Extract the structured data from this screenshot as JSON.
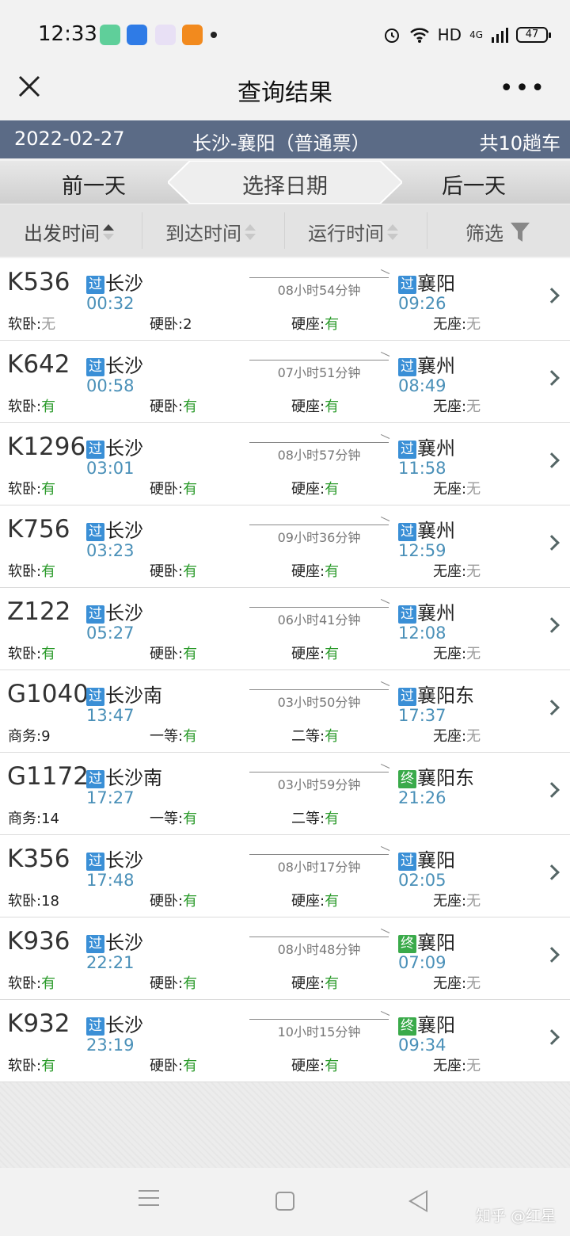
{
  "status_bar": {
    "time": "12:33",
    "network": "HD",
    "signal": "4G",
    "battery": "47"
  },
  "title_bar": {
    "title": "查询结果",
    "more": "•••"
  },
  "route": {
    "date": "2022-02-27",
    "name": "长沙-襄阳（普通票）",
    "count": "共10趟车"
  },
  "day_nav": {
    "prev": "前一天",
    "center": "选择日期",
    "next": "后一天"
  },
  "sort_bar": {
    "depart": "出发时间",
    "arrive": "到达时间",
    "duration": "运行时间",
    "filter": "筛选"
  },
  "colors": {
    "header_bg": "#5b6b86",
    "time_blue": "#4a90b8",
    "available_green": "#2a9a2a",
    "pass_badge": "#3a8fd6",
    "end_badge": "#3aaa4a"
  },
  "trains": [
    {
      "no": "K536",
      "from_badge": "过",
      "from": "长沙",
      "from_time": "00:32",
      "duration": "08小时54分钟",
      "to_badge": "过",
      "to": "襄阳",
      "to_time": "09:26",
      "seats": [
        {
          "label": "软卧:",
          "value": "无"
        },
        {
          "label": "硬卧:",
          "value": "2"
        },
        {
          "label": "硬座:",
          "value": "有"
        },
        {
          "label": "无座:",
          "value": "无"
        }
      ]
    },
    {
      "no": "K642",
      "from_badge": "过",
      "from": "长沙",
      "from_time": "00:58",
      "duration": "07小时51分钟",
      "to_badge": "过",
      "to": "襄州",
      "to_time": "08:49",
      "seats": [
        {
          "label": "软卧:",
          "value": "有"
        },
        {
          "label": "硬卧:",
          "value": "有"
        },
        {
          "label": "硬座:",
          "value": "有"
        },
        {
          "label": "无座:",
          "value": "无"
        }
      ]
    },
    {
      "no": "K1296",
      "from_badge": "过",
      "from": "长沙",
      "from_time": "03:01",
      "duration": "08小时57分钟",
      "to_badge": "过",
      "to": "襄州",
      "to_time": "11:58",
      "seats": [
        {
          "label": "软卧:",
          "value": "有"
        },
        {
          "label": "硬卧:",
          "value": "有"
        },
        {
          "label": "硬座:",
          "value": "有"
        },
        {
          "label": "无座:",
          "value": "无"
        }
      ]
    },
    {
      "no": "K756",
      "from_badge": "过",
      "from": "长沙",
      "from_time": "03:23",
      "duration": "09小时36分钟",
      "to_badge": "过",
      "to": "襄州",
      "to_time": "12:59",
      "seats": [
        {
          "label": "软卧:",
          "value": "有"
        },
        {
          "label": "硬卧:",
          "value": "有"
        },
        {
          "label": "硬座:",
          "value": "有"
        },
        {
          "label": "无座:",
          "value": "无"
        }
      ]
    },
    {
      "no": "Z122",
      "from_badge": "过",
      "from": "长沙",
      "from_time": "05:27",
      "duration": "06小时41分钟",
      "to_badge": "过",
      "to": "襄州",
      "to_time": "12:08",
      "seats": [
        {
          "label": "软卧:",
          "value": "有"
        },
        {
          "label": "硬卧:",
          "value": "有"
        },
        {
          "label": "硬座:",
          "value": "有"
        },
        {
          "label": "无座:",
          "value": "无"
        }
      ]
    },
    {
      "no": "G1040",
      "from_badge": "过",
      "from": "长沙南",
      "from_time": "13:47",
      "duration": "03小时50分钟",
      "to_badge": "过",
      "to": "襄阳东",
      "to_time": "17:37",
      "seats": [
        {
          "label": "商务:",
          "value": "9"
        },
        {
          "label": "一等:",
          "value": "有"
        },
        {
          "label": "二等:",
          "value": "有"
        },
        {
          "label": "无座:",
          "value": "无"
        }
      ]
    },
    {
      "no": "G1172",
      "from_badge": "过",
      "from": "长沙南",
      "from_time": "17:27",
      "duration": "03小时59分钟",
      "to_badge": "终",
      "to": "襄阳东",
      "to_time": "21:26",
      "seats": [
        {
          "label": "商务:",
          "value": "14"
        },
        {
          "label": "一等:",
          "value": "有"
        },
        {
          "label": "二等:",
          "value": "有"
        },
        {
          "label": "",
          "value": ""
        }
      ]
    },
    {
      "no": "K356",
      "from_badge": "过",
      "from": "长沙",
      "from_time": "17:48",
      "duration": "08小时17分钟",
      "to_badge": "过",
      "to": "襄阳",
      "to_time": "02:05",
      "seats": [
        {
          "label": "软卧:",
          "value": "18"
        },
        {
          "label": "硬卧:",
          "value": "有"
        },
        {
          "label": "硬座:",
          "value": "有"
        },
        {
          "label": "无座:",
          "value": "无"
        }
      ]
    },
    {
      "no": "K936",
      "from_badge": "过",
      "from": "长沙",
      "from_time": "22:21",
      "duration": "08小时48分钟",
      "to_badge": "终",
      "to": "襄阳",
      "to_time": "07:09",
      "seats": [
        {
          "label": "软卧:",
          "value": "有"
        },
        {
          "label": "硬卧:",
          "value": "有"
        },
        {
          "label": "硬座:",
          "value": "有"
        },
        {
          "label": "无座:",
          "value": "无"
        }
      ]
    },
    {
      "no": "K932",
      "from_badge": "过",
      "from": "长沙",
      "from_time": "23:19",
      "duration": "10小时15分钟",
      "to_badge": "终",
      "to": "襄阳",
      "to_time": "09:34",
      "seats": [
        {
          "label": "软卧:",
          "value": "有"
        },
        {
          "label": "硬卧:",
          "value": "有"
        },
        {
          "label": "硬座:",
          "value": "有"
        },
        {
          "label": "无座:",
          "value": "无"
        }
      ]
    }
  ],
  "watermark": "知乎 @红星"
}
